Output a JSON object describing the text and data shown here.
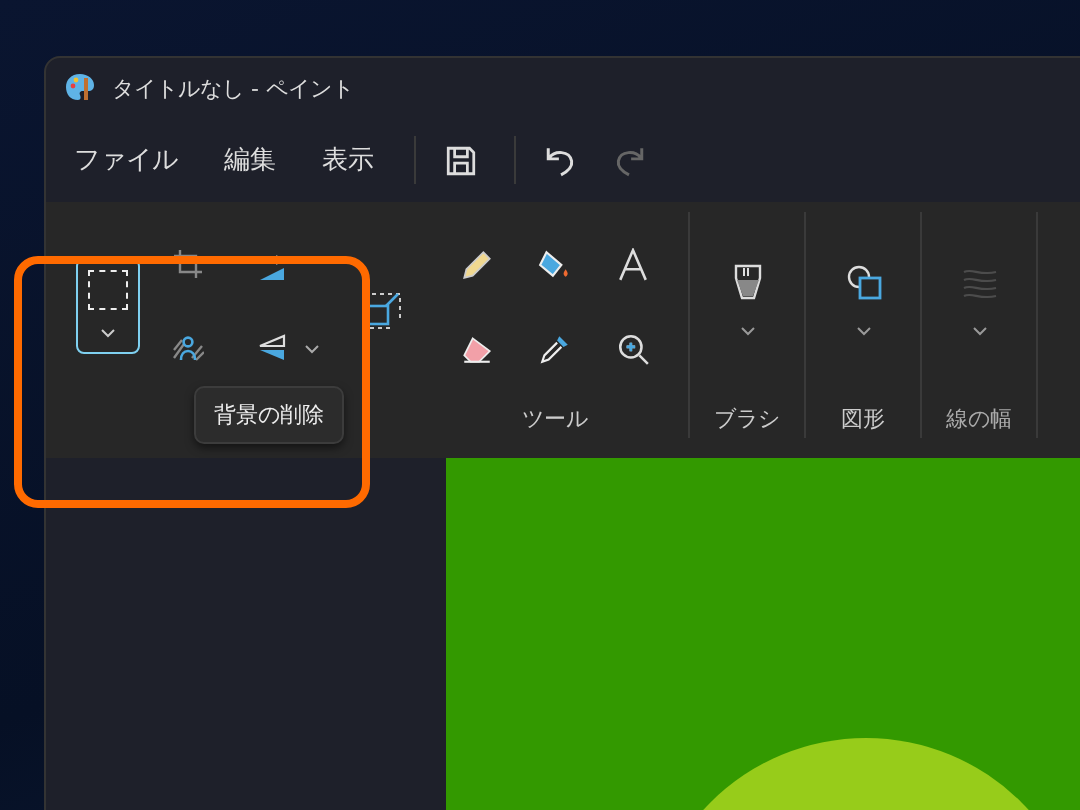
{
  "window": {
    "title": "タイトルなし - ペイント"
  },
  "menu": [
    {
      "label": "ファイル"
    },
    {
      "label": "編集"
    },
    {
      "label": "表示"
    }
  ],
  "toolbar": [
    {
      "kind": "save",
      "disabled": false
    },
    {
      "kind": "undo",
      "disabled": false
    },
    {
      "kind": "redo",
      "disabled": true
    }
  ],
  "ribbon": {
    "image_tools": [
      {
        "kind": "select",
        "selected": true
      },
      {
        "kind": "crop"
      },
      {
        "kind": "rotate"
      },
      {
        "kind": "remove-background"
      },
      {
        "kind": "flip"
      },
      {
        "kind": "resize"
      }
    ],
    "tools": [
      {
        "kind": "pencil"
      },
      {
        "kind": "fill"
      },
      {
        "kind": "text"
      },
      {
        "kind": "eraser"
      },
      {
        "kind": "picker"
      },
      {
        "kind": "magnifier"
      }
    ],
    "tools_label": "ツール",
    "groups": [
      {
        "kind": "brush",
        "label": "ブラシ",
        "disabled": false
      },
      {
        "kind": "shapes",
        "label": "図形",
        "disabled": false
      },
      {
        "kind": "width",
        "label": "線の幅",
        "disabled": true
      }
    ]
  },
  "tooltip": "背景の削除"
}
